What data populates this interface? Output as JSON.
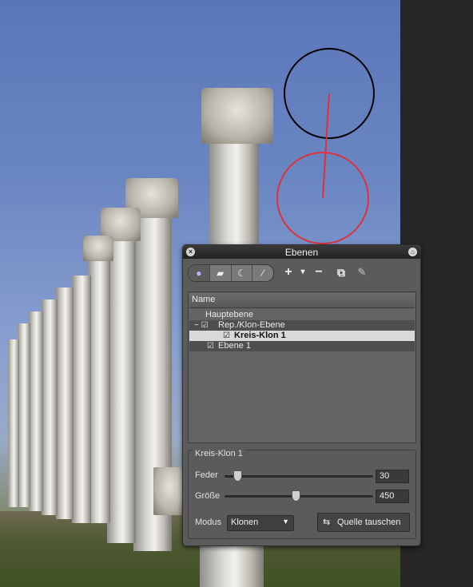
{
  "panel": {
    "title": "Ebenen",
    "close_icon": "×",
    "home_icon": "⌂"
  },
  "toolbar": {
    "tools": [
      {
        "name": "circle-tool-icon",
        "glyph": "●"
      },
      {
        "name": "shape-tool-icon",
        "glyph": "▰"
      },
      {
        "name": "lasso-tool-icon",
        "glyph": "☾"
      },
      {
        "name": "brush-tool-icon",
        "glyph": "⁄"
      }
    ],
    "add_glyph": "+",
    "dropdown_glyph": "▾",
    "remove_glyph": "−",
    "new_layer_glyph": "⧉",
    "edit_glyph": "✎"
  },
  "layers": {
    "header": "Name",
    "rows": [
      {
        "label": "Hauptebene",
        "prefix": "",
        "indent": 0
      },
      {
        "label": "Rep./Klon-Ebene",
        "prefix": "− ☑",
        "indent": 1
      },
      {
        "label": "Kreis-Klon 1",
        "prefix": "☑",
        "indent": 2
      },
      {
        "label": "Ebene 1",
        "prefix": "☑",
        "indent": 1
      }
    ]
  },
  "properties": {
    "title": "Kreis-Klon 1",
    "feder_label": "Feder",
    "feder_value": "30",
    "feder_level": 0.06,
    "groesse_label": "Größe",
    "groesse_value": "450",
    "groesse_level": 0.45,
    "modus_label": "Modus",
    "modus_value": "Klonen",
    "modus_arrow": "▼",
    "swap_label": "Quelle tauschen",
    "swap_icon": "⇆"
  },
  "colors": {
    "source_circle": "#000000",
    "target_circle": "#e0303a",
    "connector": "#e0303a"
  }
}
